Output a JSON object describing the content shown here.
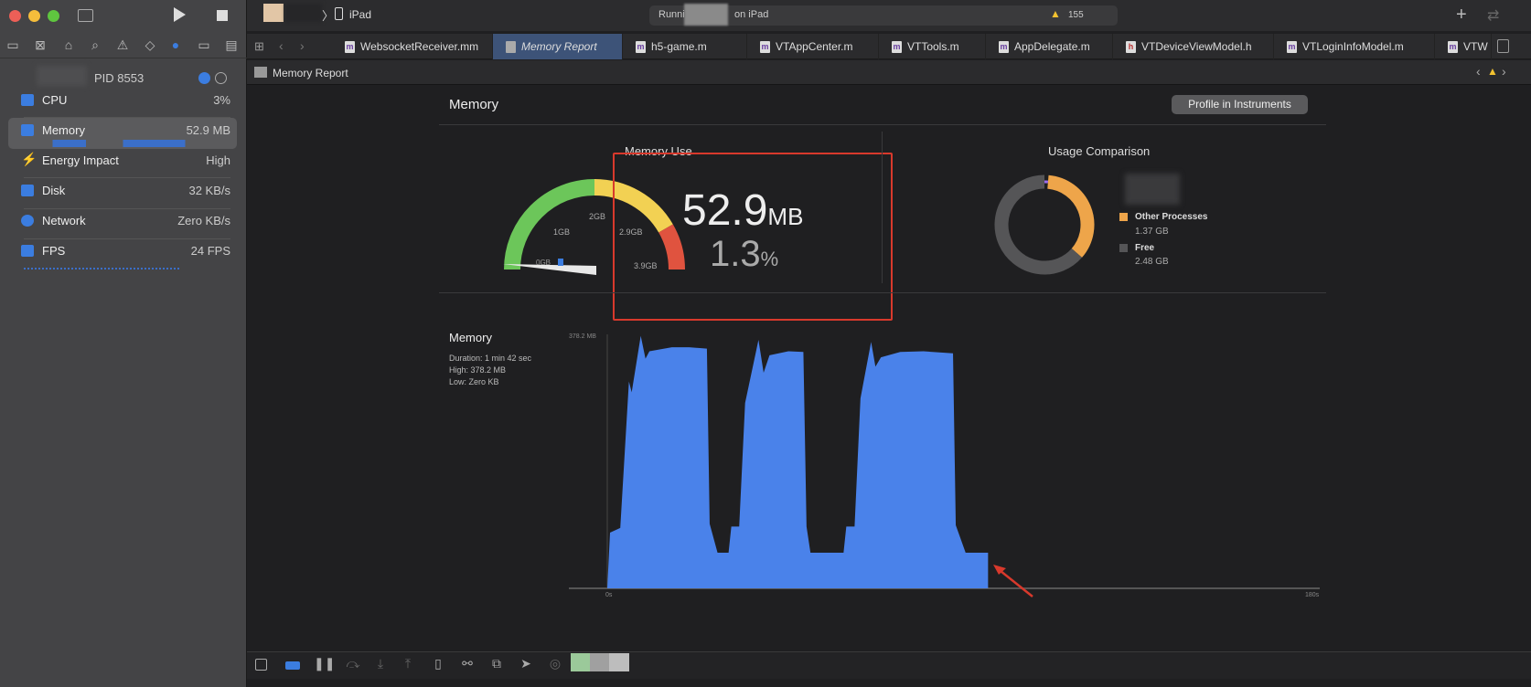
{
  "window": {
    "controls": [
      "close",
      "minimize",
      "zoom"
    ]
  },
  "toolbar": {
    "device": "iPad",
    "activity_prefix": "Runni",
    "activity_suffix": "on iPad",
    "warning_count": "155"
  },
  "sidebar": {
    "pid": "PID 8553",
    "items": [
      {
        "label": "CPU",
        "value": "3%",
        "icon": "cpu-icon"
      },
      {
        "label": "Memory",
        "value": "52.9 MB",
        "icon": "memory-icon",
        "selected": true
      },
      {
        "label": "Energy Impact",
        "value": "High",
        "icon": "bolt-icon"
      },
      {
        "label": "Disk",
        "value": "32 KB/s",
        "icon": "disk-icon"
      },
      {
        "label": "Network",
        "value": "Zero KB/s",
        "icon": "globe-icon"
      },
      {
        "label": "FPS",
        "value": "24 FPS",
        "icon": "fps-icon"
      }
    ]
  },
  "tabs": [
    {
      "label": "WebsocketReceiver.mm",
      "type": "m"
    },
    {
      "label": "Memory Report",
      "type": "report",
      "selected": true
    },
    {
      "label": "h5-game.m",
      "type": "m"
    },
    {
      "label": "VTAppCenter.m",
      "type": "m"
    },
    {
      "label": "VTTools.m",
      "type": "m"
    },
    {
      "label": "AppDelegate.m",
      "type": "m"
    },
    {
      "label": "VTDeviceViewModel.h",
      "type": "h"
    },
    {
      "label": "VTLoginInfoModel.m",
      "type": "m"
    },
    {
      "label": "VTW",
      "type": "m"
    }
  ],
  "jumpbar": {
    "label": "Memory Report"
  },
  "report": {
    "title": "Memory",
    "profile_button": "Profile in Instruments",
    "memory_use": {
      "title": "Memory Use",
      "value": "52.9",
      "unit": "MB",
      "percent": "1.3",
      "percent_unit": "%",
      "gauge_labels": [
        "0GB",
        "1GB",
        "2GB",
        "2.9GB",
        "3.9GB"
      ],
      "colors": {
        "green": "#6cc65a",
        "yellow": "#f2d153",
        "red": "#e0533f"
      }
    },
    "usage": {
      "title": "Usage Comparison",
      "legend": [
        {
          "label": "Other Processes",
          "value": "1.37 GB",
          "color": "#eea54a"
        },
        {
          "label": "Free",
          "value": "2.48 GB",
          "color": "#555557"
        }
      ],
      "app_color": "#9b6cf0"
    },
    "graph": {
      "title": "Memory",
      "duration": "Duration: 1 min 42 sec",
      "high": "High: 378.2 MB",
      "low": "Low: Zero KB"
    }
  },
  "chart_data": {
    "type": "area",
    "ylabel_top": "378.2 MB",
    "ylim": [
      0,
      378.2
    ],
    "xlim": [
      0,
      180
    ],
    "x_ticks": [
      "0s",
      "180s"
    ],
    "color": "#4a82ea",
    "x": [
      0,
      0.7,
      3.3,
      5.5,
      6.2,
      8.5,
      9.7,
      10.7,
      16.4,
      20.8,
      25.3,
      26,
      28,
      30.8,
      31.5,
      33.5,
      35,
      38.4,
      39.7,
      41.2,
      46,
      49.8,
      50.6,
      51.6,
      60,
      60.7,
      62.8,
      64.3,
      67,
      68.1,
      69.5,
      74.4,
      80.3,
      87.8,
      88.5,
      91,
      96.7
    ],
    "y": [
      0,
      83,
      90,
      308,
      292,
      376,
      342,
      353,
      359,
      359,
      357,
      96,
      53,
      53,
      92,
      92,
      276,
      370,
      321,
      347,
      353,
      352,
      92,
      53,
      53,
      92,
      92,
      283,
      367,
      330,
      344,
      352,
      353,
      350,
      94,
      53,
      53
    ]
  }
}
